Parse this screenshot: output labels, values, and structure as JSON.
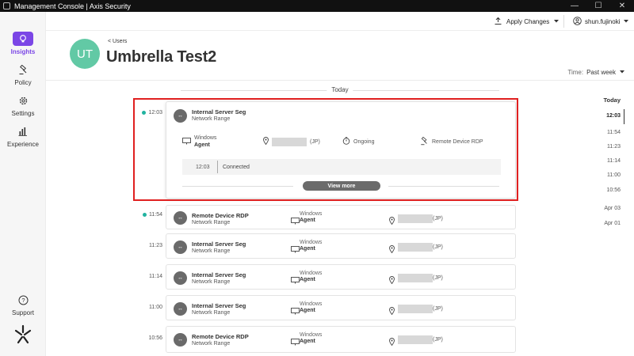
{
  "window": {
    "title": "Management Console | Axis Security",
    "controls": [
      "—",
      "☐",
      "✕"
    ]
  },
  "sidebar": {
    "items": [
      {
        "label": "Insights",
        "icon": "lightbulb-icon",
        "active": true
      },
      {
        "label": "Policy",
        "icon": "gavel-icon"
      },
      {
        "label": "Settings",
        "icon": "gear-icon"
      },
      {
        "label": "Experience",
        "icon": "bar-chart-icon"
      }
    ],
    "support": {
      "label": "Support",
      "icon": "question-icon"
    },
    "logo": "axis-logo"
  },
  "topbar": {
    "apply_label": "Apply Changes",
    "user_label": "shun.fujinoki"
  },
  "header": {
    "avatar": "UT",
    "back_label": "< Users",
    "title": "Umbrella Test2",
    "time_key": "Time:",
    "time_value": "Past week"
  },
  "day_label": "Today",
  "expanded": {
    "time": "12:03",
    "name": "Internal Server Seg",
    "sub": "Network Range",
    "os": "Windows",
    "agent": "Agent",
    "location_suffix": "(JP)",
    "status": "Ongoing",
    "via": "Remote Device RDP",
    "conn_time": "12:03",
    "conn_status": "Connected",
    "view_more": "View more"
  },
  "rows": [
    {
      "time": "11:54",
      "live": true,
      "name": "Remote Device RDP",
      "sub": "Network Range",
      "os": "Windows",
      "agent": "Agent",
      "loc": "(JP)"
    },
    {
      "time": "11:23",
      "live": false,
      "name": "Internal Server Seg",
      "sub": "Network Range",
      "os": "Windows",
      "agent": "Agent",
      "loc": "(JP)"
    },
    {
      "time": "11:14",
      "live": false,
      "name": "Internal Server Seg",
      "sub": "Network Range",
      "os": "Windows",
      "agent": "Agent",
      "loc": "(JP)"
    },
    {
      "time": "11:00",
      "live": false,
      "name": "Internal Server Seg",
      "sub": "Network Range",
      "os": "Windows",
      "agent": "Agent",
      "loc": "(JP)"
    },
    {
      "time": "10:56",
      "live": false,
      "name": "Remote Device RDP",
      "sub": "Network Range",
      "os": "Windows",
      "agent": "Agent",
      "loc": "(JP)"
    }
  ],
  "scroller": {
    "today": "Today",
    "times": [
      "12:03",
      "11:54",
      "11:23",
      "11:14",
      "11:00",
      "10:56"
    ],
    "dates": [
      "Apr 03",
      "Apr 01"
    ]
  },
  "colors": {
    "accent": "#7b46e6",
    "live": "#21b3a0",
    "avatar": "#62c9a5",
    "highlight": "#e02020"
  }
}
